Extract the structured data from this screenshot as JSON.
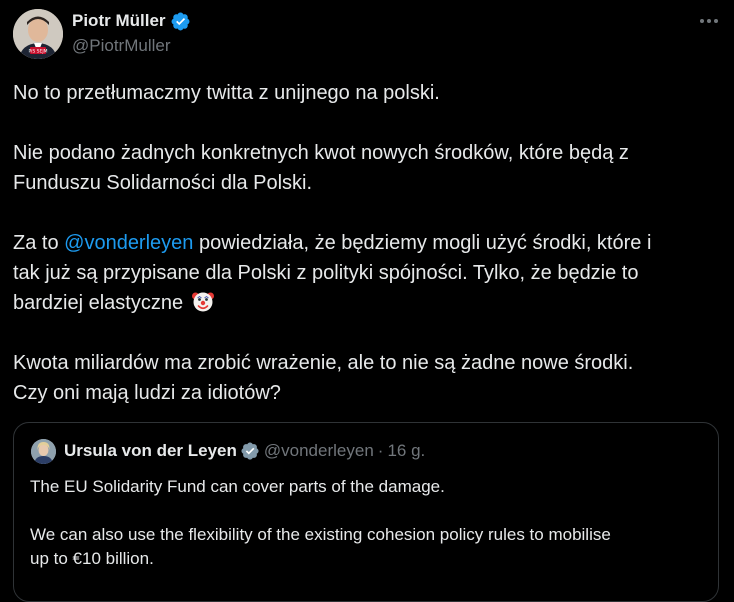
{
  "author": {
    "name": "Piotr Müller",
    "handle": "@PiotrMuller",
    "avatar_badge": "PiS SEJM"
  },
  "tweet": {
    "line1": "No to przetłumaczmy twitta z unijnego na polski.",
    "para2_line1": "Nie podano żadnych konkretnych kwot nowych środków, które będą z",
    "para2_line2": "Funduszu Solidarności dla Polski.",
    "para3_prefix": "Za to ",
    "para3_mention": "@vonderleyen",
    "para3_line1_suffix": " powiedziała, że będziemy mogli użyć środki, które i",
    "para3_line2": "tak już są przypisane dla Polski z polityki spójności. Tylko, że będzie to",
    "para3_line3": "bardziej elastyczne",
    "para4_line1": "Kwota miliardów ma zrobić wrażenie, ale to nie są żadne nowe środki.",
    "para4_line2": "Czy oni mają ludzi za idiotów?"
  },
  "quote": {
    "name": "Ursula von der Leyen",
    "handle": "@vonderleyen",
    "separator": "·",
    "time": "16 g.",
    "line1": "The EU Solidarity Fund can cover parts of the damage.",
    "line2": "We can also use the flexibility of the existing cohesion policy rules to mobilise",
    "line3": "up to €10 billion."
  },
  "icons": {
    "verified": "verified-badge-icon",
    "more": "more-options-icon",
    "clown": "clown-face-emoji"
  },
  "colors": {
    "background": "#000000",
    "text": "#e7e9ea",
    "secondary": "#71767b",
    "accent": "#1d9bf0",
    "border": "#2f3336"
  }
}
